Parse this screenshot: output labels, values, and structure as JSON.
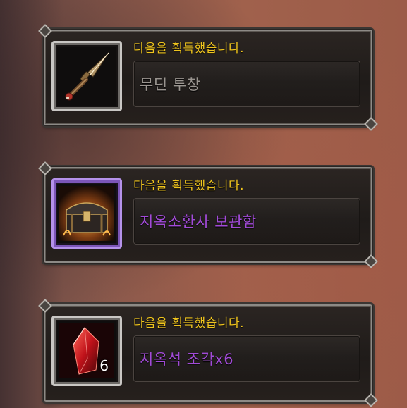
{
  "notifications": [
    {
      "title": "다음을 획득했습니다.",
      "item_name": "무딘 투창",
      "item_color": "#9a9590",
      "icon": "spear-icon",
      "rarity_frame": "common",
      "count": ""
    },
    {
      "title": "다음을 획득했습니다.",
      "item_name": "지옥소환사 보관함",
      "item_color": "#a24bd8",
      "icon": "treasure-chest-icon",
      "rarity_frame": "epic",
      "count": ""
    },
    {
      "title": "다음을 획득했습니다.",
      "item_name": "지옥석 조각x6",
      "item_color": "#a24bd8",
      "icon": "red-crystal-icon",
      "rarity_frame": "common",
      "count": "6"
    }
  ]
}
